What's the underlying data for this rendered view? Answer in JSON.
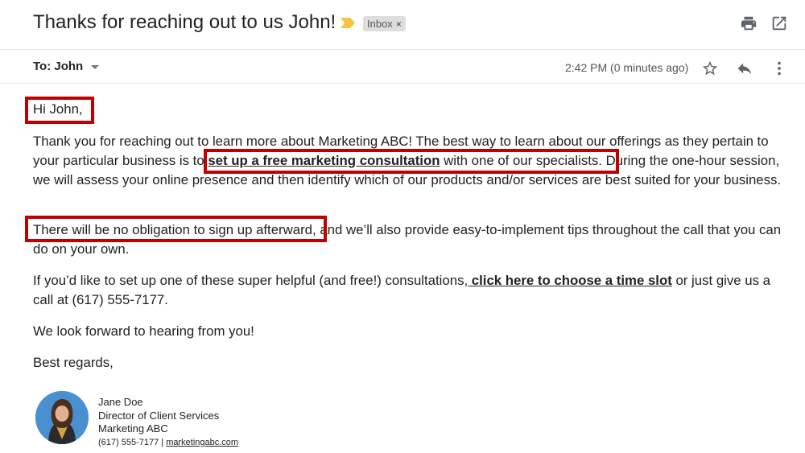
{
  "email": {
    "subject": "Thanks for reaching out to us John!",
    "label_chip": "Inbox",
    "label_chip_close": "×",
    "to": "To: John",
    "timestamp": "2:42 PM (0 minutes ago)"
  },
  "icons": {
    "importance": "importance-marker-icon",
    "print": "print-icon",
    "open_new_window": "open-in-new-window-icon",
    "expand": "chevron-down-icon",
    "star": "star-icon",
    "reply": "reply-icon",
    "more": "more-vert-icon"
  },
  "colors": {
    "highlight_box": "#c00000",
    "importance_marker": "#f6c342",
    "avatar_bg": "#4a8fcf"
  },
  "body": {
    "greeting": "Hi John,",
    "p1_part1": "Thank you for reaching out to learn more about Marketing ABC! The best way to learn about our offerings as they pertain to your particular business is to ",
    "p1_link": "set up a free marketing consultation",
    "p1_part2": " with one of our specialists. During the one-hour session, we will assess your online presence and then identify which of our products and/or services are best suited for your business.",
    "p2_part1": "There will be no obligation to sign up afterward,",
    "p2_part2": " and we’ll also provide easy-to-implement tips throughout the call that you can do on your own.",
    "p3_part1": "If you’d like to set up one of these super helpful (and free!) consultations,",
    "p3_link": " click here to choose a time slot",
    "p3_part2": " or just give us a call at (617) 555-7177.",
    "p4": "We look forward to hearing from you!",
    "p5": "Best regards,"
  },
  "signature": {
    "name": "Jane Doe",
    "title": "Director of Client Services",
    "company": "Marketing ABC",
    "phone": "(617) 555-7177",
    "separator": " | ",
    "website": "marketingabc.com"
  }
}
